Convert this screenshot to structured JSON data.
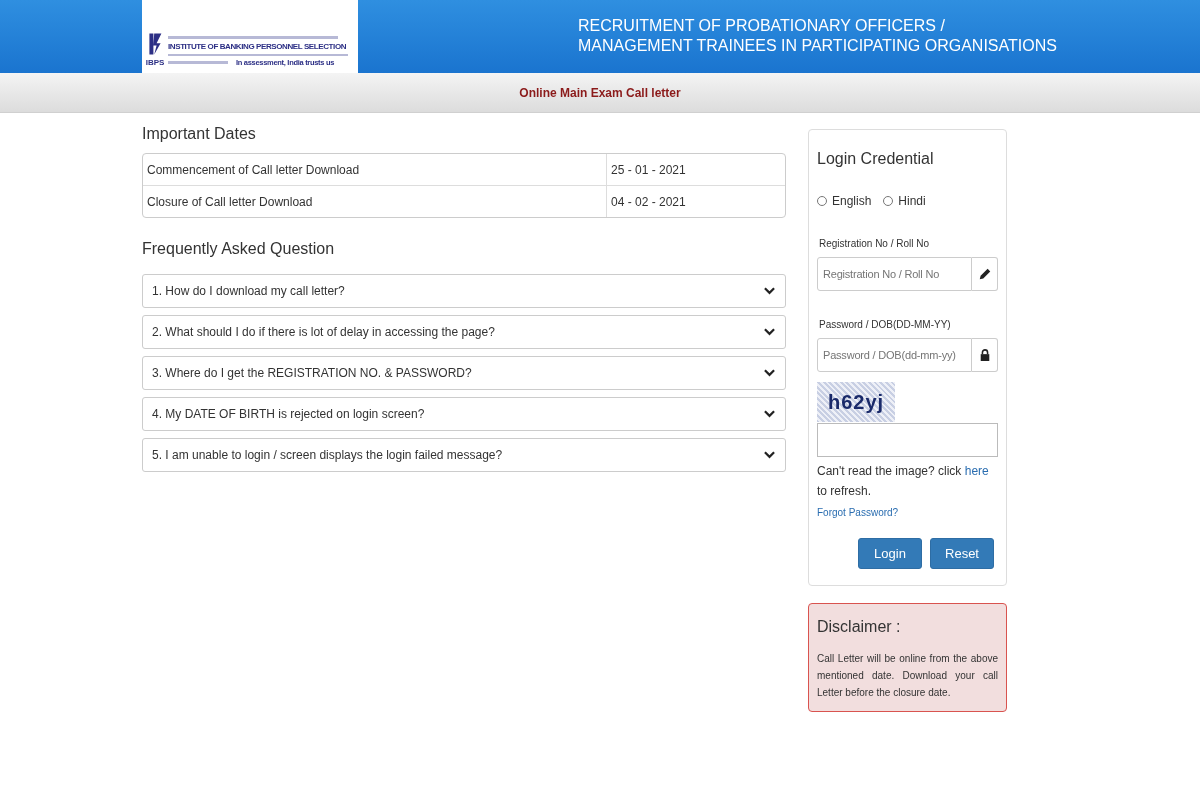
{
  "header": {
    "logo": {
      "mark": "IBPS",
      "name": "INSTITUTE OF BANKING PERSONNEL SELECTION",
      "motto": "In assessment, India trusts us"
    },
    "title_lines": [
      "RECRUITMENT OF PROBATIONARY OFFICERS /",
      "MANAGEMENT TRAINEES IN PARTICIPATING ORGANISATIONS"
    ]
  },
  "subheader": "Online Main Exam Call letter",
  "important_dates": {
    "title": "Important Dates",
    "rows": [
      {
        "label": "Commencement of Call letter Download",
        "date": "25 - 01 - 2021"
      },
      {
        "label": "Closure of Call letter Download",
        "date": "04 - 02 - 2021"
      }
    ]
  },
  "faq": {
    "title": "Frequently Asked Question",
    "items": [
      {
        "question": "1. How do I download my call letter?",
        "expanded": false
      },
      {
        "question": "2. What should I do if there is lot of delay in accessing the page?",
        "expanded": false
      },
      {
        "question": "3. Where do I get the REGISTRATION NO. & PASSWORD?",
        "expanded": false
      },
      {
        "question": "4. My DATE OF BIRTH is rejected on login screen?",
        "expanded": false
      },
      {
        "question": "5. I am unable to login / screen displays the login failed message?",
        "expanded": false
      }
    ]
  },
  "login": {
    "title": "Login Credential",
    "languages": [
      {
        "label": "English",
        "selected": false
      },
      {
        "label": "Hindi",
        "selected": false
      }
    ],
    "fields": [
      {
        "label": "Registration No / Roll No",
        "placeholder": "Registration No / Roll No",
        "kind": "text"
      },
      {
        "label": "Password / DOB(DD-MM-YY)",
        "placeholder": "Password / DOB(dd-mm-yy)",
        "kind": "password"
      }
    ],
    "captcha": "h62yj",
    "refresh_before": "Can't read the image? click",
    "refresh_link": "here",
    "refresh_after": "to refresh.",
    "forgot": "Forgot Password?",
    "buttons": [
      "Login",
      "Reset"
    ]
  },
  "disclaimer": {
    "title": "Disclaimer :",
    "text": "Call Letter will be online from the above mentioned date. Download your call Letter before the closure date."
  }
}
